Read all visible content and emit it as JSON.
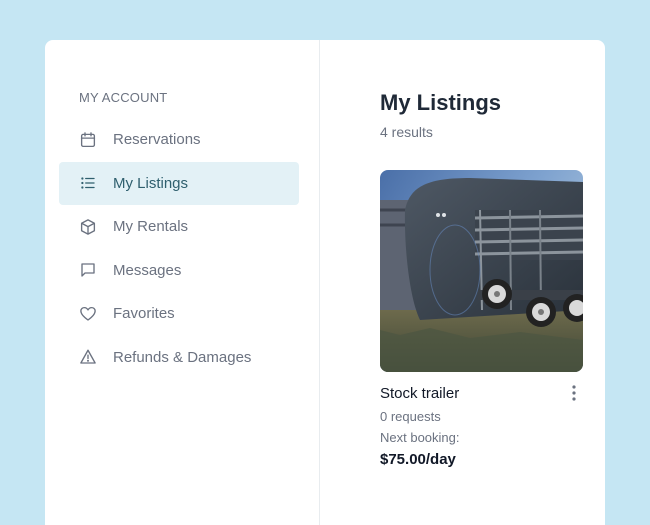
{
  "sidebar": {
    "heading": "MY ACCOUNT",
    "items": [
      {
        "label": "Reservations",
        "icon": "calendar-icon",
        "active": false
      },
      {
        "label": "My Listings",
        "icon": "list-icon",
        "active": true
      },
      {
        "label": "My Rentals",
        "icon": "cube-icon",
        "active": false
      },
      {
        "label": "Messages",
        "icon": "message-icon",
        "active": false
      },
      {
        "label": "Favorites",
        "icon": "heart-icon",
        "active": false
      },
      {
        "label": "Refunds & Damages",
        "icon": "warning-icon",
        "active": false
      }
    ]
  },
  "main": {
    "title": "My Listings",
    "result_count": "4 results",
    "listings": [
      {
        "title": "Stock trailer",
        "requests": "0 requests",
        "next_booking": "Next booking:",
        "price": "$75.00/day",
        "image": "stock-trailer-photo"
      }
    ]
  },
  "colors": {
    "background": "#c5e6f3",
    "active_item_bg": "#e3f1f6",
    "active_item_text": "#2f5f6e",
    "muted_text": "#6b7280"
  }
}
